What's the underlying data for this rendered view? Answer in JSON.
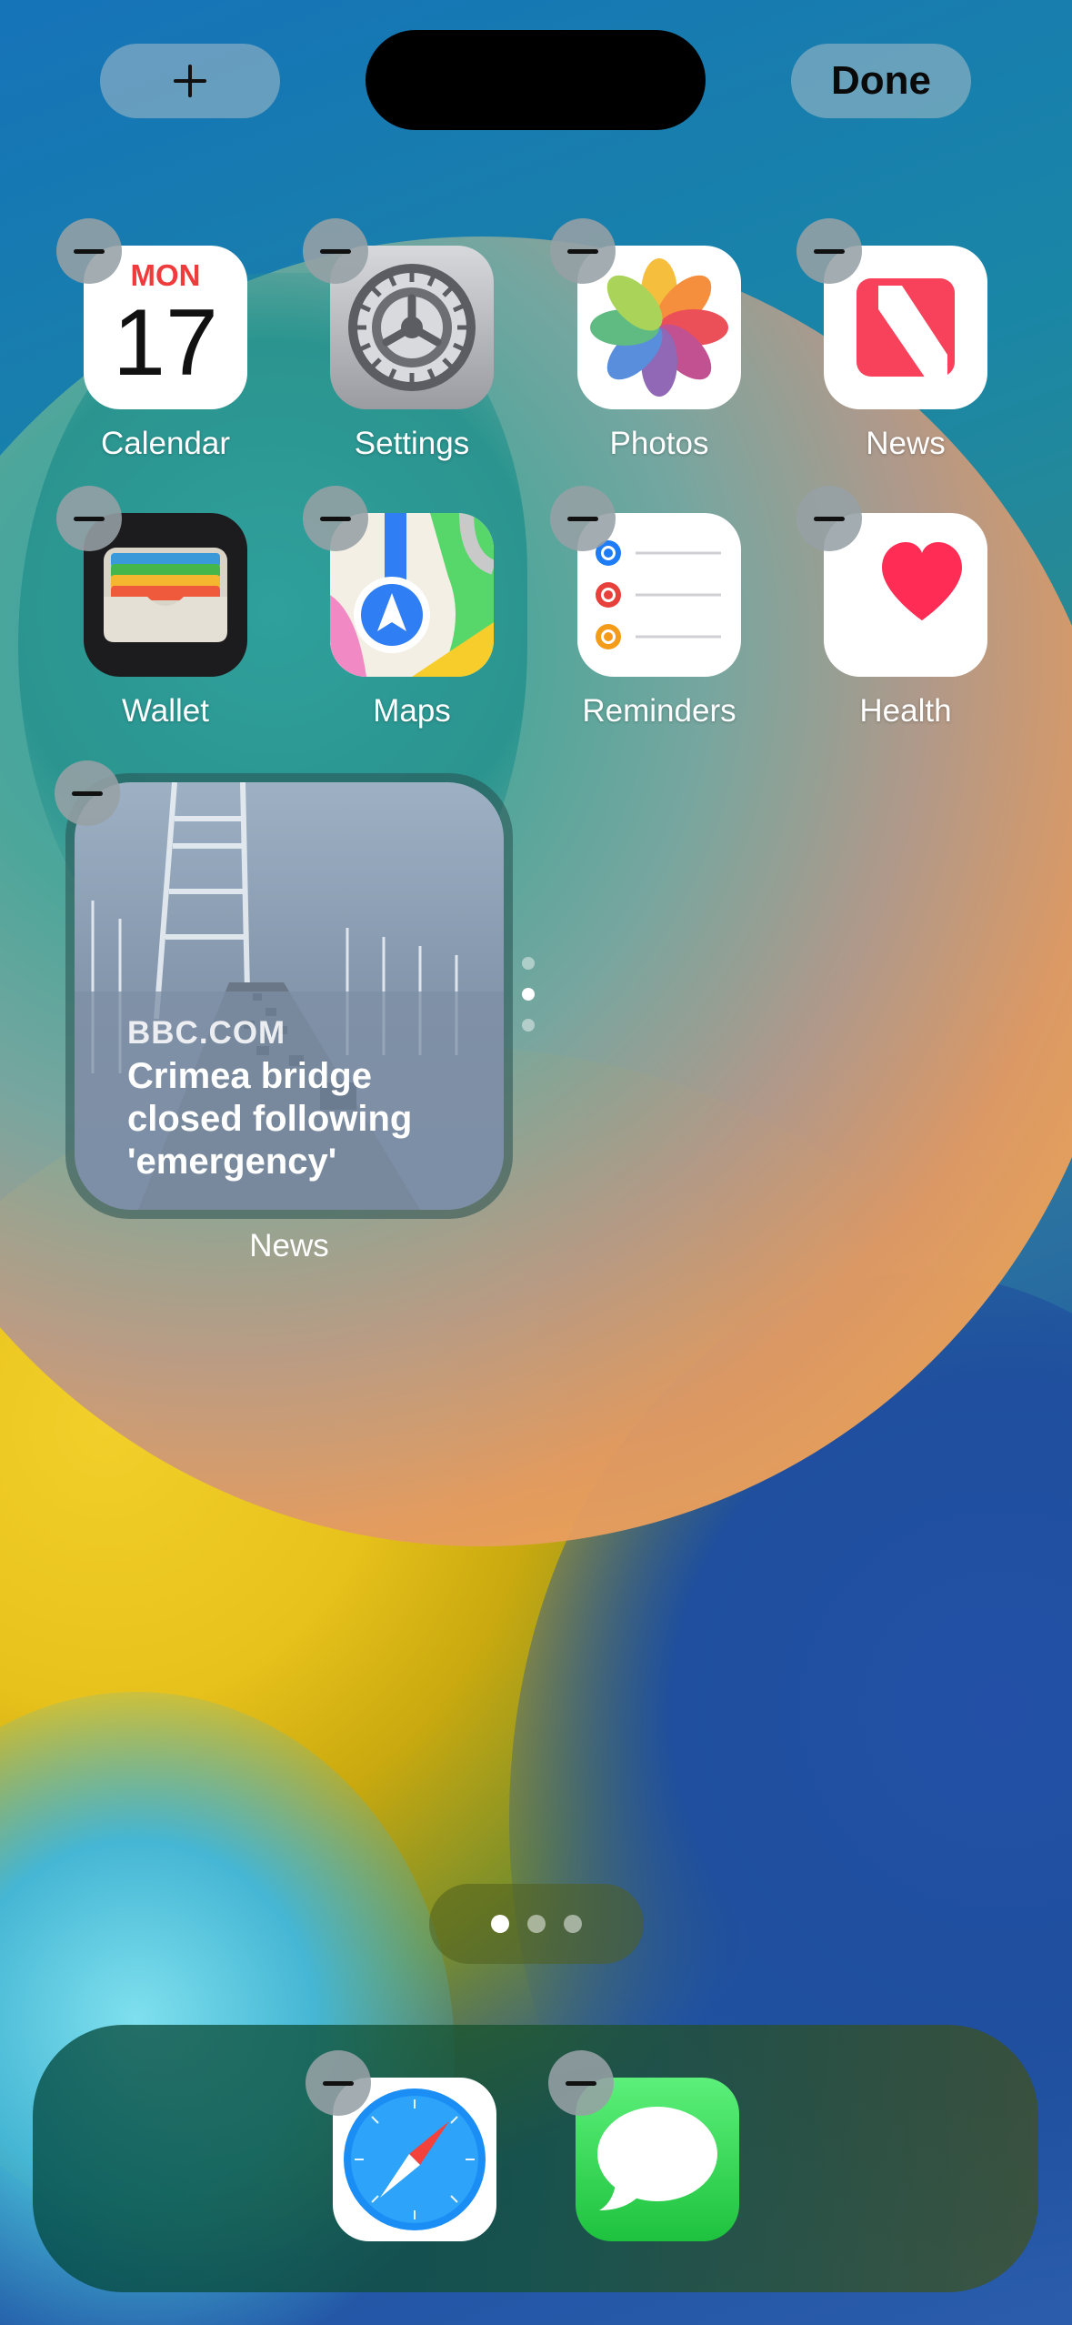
{
  "top_bar": {
    "add_symbol": "+",
    "done_label": "Done"
  },
  "apps_row1": [
    {
      "label": "Calendar",
      "icon": "calendar-icon",
      "day": "MON",
      "date": "17"
    },
    {
      "label": "Settings",
      "icon": "settings-gear-icon"
    },
    {
      "label": "Photos",
      "icon": "photos-flower-icon"
    },
    {
      "label": "News",
      "icon": "news-icon"
    }
  ],
  "apps_row2": [
    {
      "label": "Wallet",
      "icon": "wallet-icon"
    },
    {
      "label": "Maps",
      "icon": "maps-icon"
    },
    {
      "label": "Reminders",
      "icon": "reminders-icon"
    },
    {
      "label": "Health",
      "icon": "health-heart-icon"
    }
  ],
  "news_widget": {
    "source": "BBC.COM",
    "headline": "Crimea bridge closed following 'emergency'",
    "label": "News",
    "stack_pages": 3,
    "stack_active": 2
  },
  "page_indicator": {
    "pages": 3,
    "active": 1
  },
  "dock": [
    {
      "name": "Safari",
      "icon": "safari-compass-icon"
    },
    {
      "name": "Messages",
      "icon": "messages-bubble-icon"
    }
  ],
  "colors": {
    "calendar_red": "#ef3b3b",
    "news_red": "#f8415a",
    "health_red": "#ff2d55"
  }
}
